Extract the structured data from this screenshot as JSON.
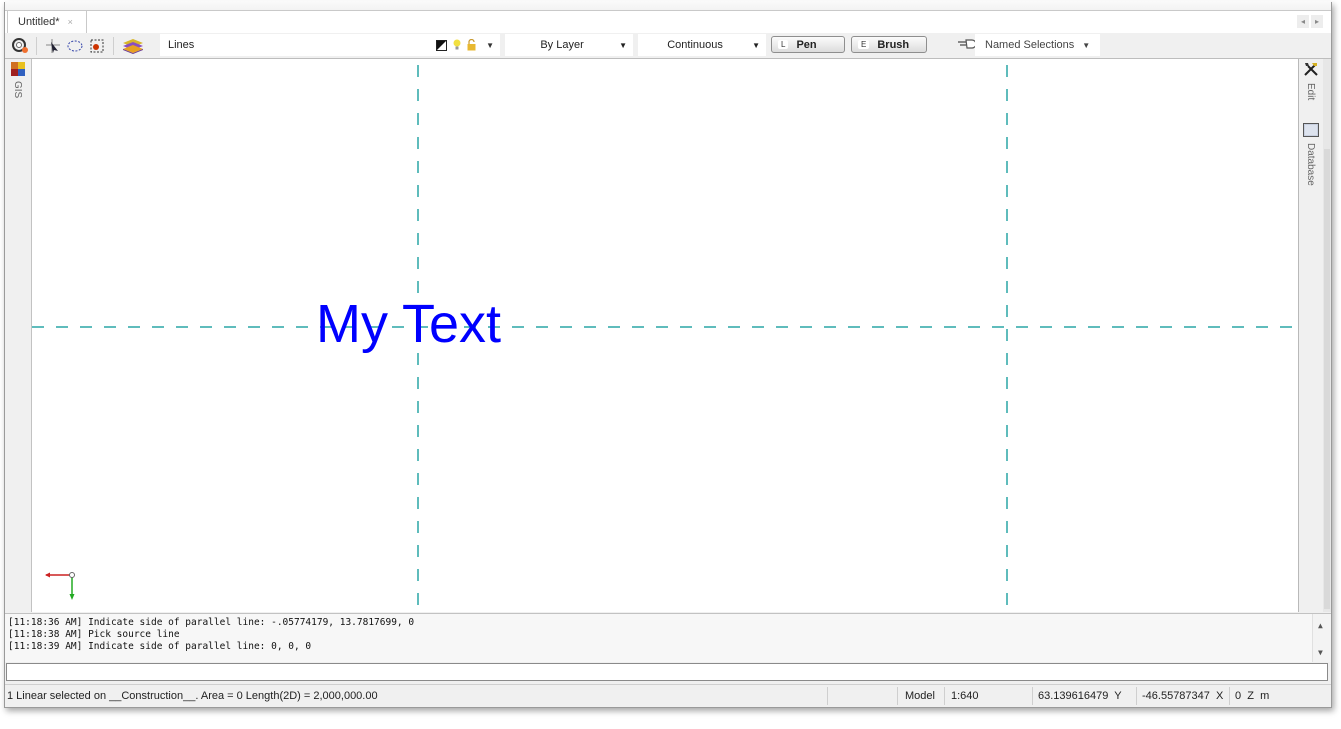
{
  "document": {
    "tab_label": "Untitled*",
    "tab_close": "×",
    "scroll_left": "◂",
    "scroll_right": "▸"
  },
  "toolbar": {
    "layer_name": "Lines",
    "color_combo": "By Layer",
    "linetype_combo": "Continuous",
    "pen_key": "L",
    "pen_label": "Pen",
    "brush_key": "E",
    "brush_label": "Brush",
    "named_selections": "Named Selections",
    "dropdown_arrow": "▼"
  },
  "left_dock": {
    "tabs": [
      {
        "label": "GIS",
        "icon": "gis-icon"
      }
    ]
  },
  "right_dock": {
    "tabs": [
      {
        "label": "Edit",
        "icon": "hammer-wrench-icon"
      },
      {
        "label": "Database",
        "icon": "database-table-icon"
      }
    ]
  },
  "canvas": {
    "text_object": "My Text",
    "text_color": "#0000ff",
    "construction_line_color": "#5fbcbc",
    "ucs_x_color": "#cc2222",
    "ucs_y_color": "#22aa22"
  },
  "history": {
    "lines": [
      "[11:18:36 AM] Indicate side of parallel line: -.05774179, 13.7817699, 0",
      "[11:18:38 AM] Pick source line",
      "[11:18:39 AM] Indicate side of parallel line: 0, 0, 0"
    ],
    "scroll_up": "▲",
    "scroll_down": "▼"
  },
  "command_input": {
    "value": "",
    "placeholder": ""
  },
  "status_bar": {
    "selection_info": "1 Linear selected on __Construction__.  Area = 0   Length(2D) = 2,000,000.00",
    "space": "Model",
    "scale": "1:640",
    "y_value": "63.139616479",
    "y_label": "Y",
    "x_value": "-46.55787347",
    "x_label": "X",
    "z_value": "0",
    "z_label": "Z",
    "units": "m"
  }
}
